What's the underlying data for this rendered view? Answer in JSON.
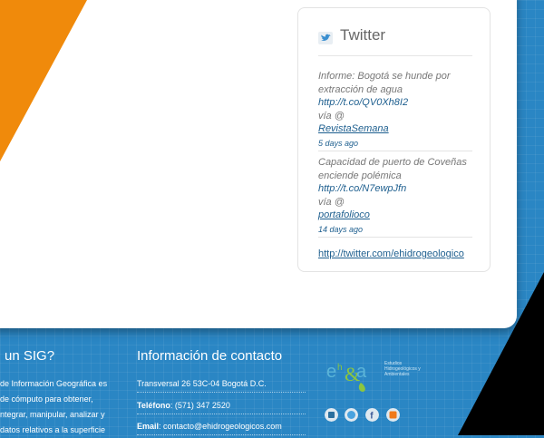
{
  "twitter": {
    "title": "Twitter",
    "tweets": [
      {
        "text": "Informe: Bogotá se hunde por extracción de agua",
        "link": "http://t.co/QV0Xh8I2",
        "via": "vía @",
        "user": "RevistaSemana",
        "ago": "5 days ago"
      },
      {
        "text": "Capacidad de puerto de Coveñas enciende polémica",
        "link": "http://t.co/N7ewpJfn",
        "via": "vía @",
        "user": "portafolioco",
        "ago": "14 days ago"
      }
    ],
    "profile_link": "http://twitter.com/ehidrogeologico"
  },
  "footer": {
    "sig_title": "un SIG?",
    "sig_lines": [
      "de Información Geográfica es",
      "de cómputo para obtener,",
      "ntegrar, manipular, analizar y",
      "datos relativos a la superficie"
    ],
    "contact_title": "Información de contacto",
    "address": "Transversal 26 53C-04 Bogotá D.C.",
    "phone_label": "Teléfono",
    "phone": ": (571) 347 2520",
    "email_label": "Email",
    "email": ": contacto@ehidrogeologicos.com"
  },
  "logo": {
    "text": "Estudios Hidrogeológicos y Ambientales"
  },
  "colors": {
    "accent_orange": "#f08a0b",
    "footer_blue": "#2a86c4",
    "link_blue": "#1e5f8f"
  }
}
